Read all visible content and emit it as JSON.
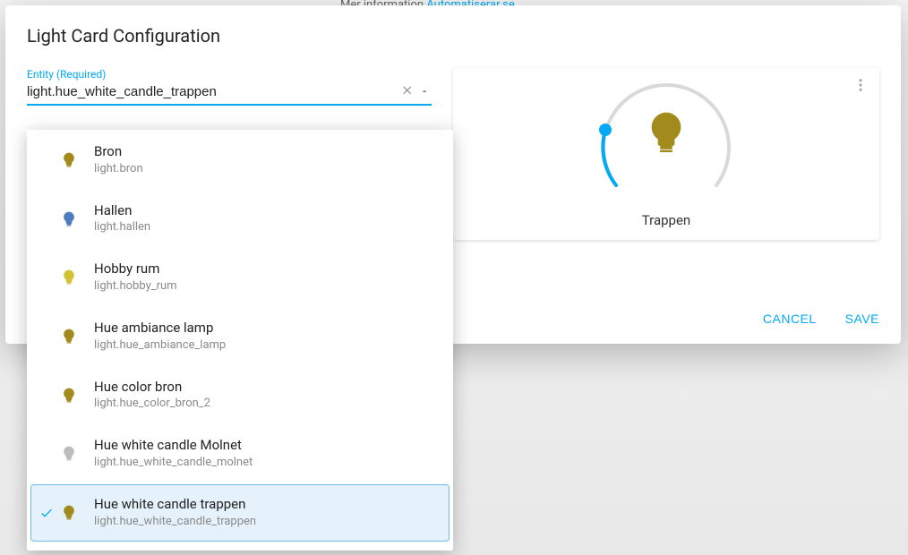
{
  "backdrop": {
    "hint_prefix": "Mer information ",
    "hint_link": "Automatiserar.se"
  },
  "dialog": {
    "title": "Light Card Configuration",
    "entity_label": "Entity (Required)",
    "entity_value": "light.hue_white_candle_trappen",
    "actions": {
      "cancel": "CANCEL",
      "save": "SAVE"
    }
  },
  "preview": {
    "name": "Trappen",
    "bulb_color": "#a38a1d",
    "accent": "#03a9f4"
  },
  "entities": [
    {
      "name": "Bron",
      "id": "light.bron",
      "bulb": "#a38a1d",
      "selected": false
    },
    {
      "name": "Hallen",
      "id": "light.hallen",
      "bulb": "#4b7dbf",
      "selected": false
    },
    {
      "name": "Hobby rum",
      "id": "light.hobby_rum",
      "bulb": "#d2c233",
      "selected": false
    },
    {
      "name": "Hue ambiance lamp",
      "id": "light.hue_ambiance_lamp",
      "bulb": "#a38a1d",
      "selected": false
    },
    {
      "name": "Hue color bron",
      "id": "light.hue_color_bron_2",
      "bulb": "#a38a1d",
      "selected": false
    },
    {
      "name": "Hue white candle Molnet",
      "id": "light.hue_white_candle_molnet",
      "bulb": "#bdbdbd",
      "selected": false
    },
    {
      "name": "Hue white candle trappen",
      "id": "light.hue_white_candle_trappen",
      "bulb": "#a38a1d",
      "selected": true
    }
  ]
}
